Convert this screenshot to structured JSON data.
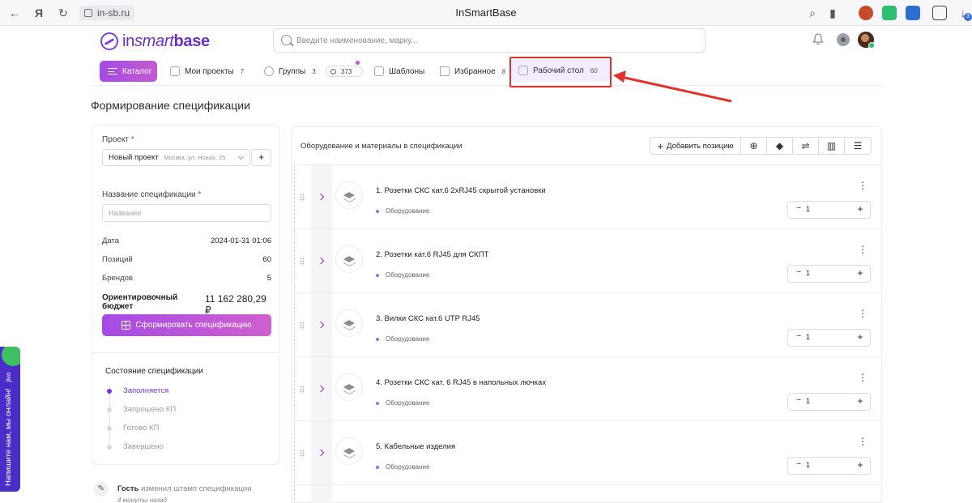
{
  "browser": {
    "url": "in-sb.ru",
    "title": "InSmartBase",
    "download_badge": "3"
  },
  "header": {
    "logo": {
      "part1": "in",
      "part2": "smart",
      "part3": "base"
    },
    "search_placeholder": "Введите наименование, марку..."
  },
  "nav": {
    "catalog": "Каталог",
    "items": [
      {
        "label": "Мои проекты",
        "count": "7"
      },
      {
        "label": "Группы",
        "count": "3"
      },
      {
        "label": "Шаблоны",
        "count": ""
      },
      {
        "label": "Избранное",
        "count": "8"
      },
      {
        "label": "Рабочий стол",
        "count": "60"
      }
    ],
    "badge_count": "373"
  },
  "page": {
    "title": "Формирование спецификации"
  },
  "spec_form": {
    "project_label": "Проект",
    "project_value": "Новый проект",
    "project_address": "Москва, ул. Новая, 25",
    "add_project": "+",
    "name_label": "Название спецификации",
    "name_placeholder": "Название",
    "required_mark": "*",
    "date_label": "Дата",
    "date_value": "2024-01-31 01:06",
    "positions_label": "Позиций",
    "positions_value": "60",
    "brands_label": "Брендов",
    "brands_value": "5",
    "budget_label": "Ориентировочный бюджет",
    "budget_value": "11 162 280,29 ₽",
    "submit_button": "Сформировать спецификацию"
  },
  "spec_status": {
    "title": "Состояние спецификации",
    "steps": [
      {
        "label": "Заполняется",
        "active": true
      },
      {
        "label": "Запрошено КП",
        "active": false
      },
      {
        "label": "Готово КП",
        "active": false
      },
      {
        "label": "Завершено",
        "active": false
      }
    ]
  },
  "activity": {
    "who": "Гость",
    "action": "изменил штамп спецификации",
    "time": "4 минуты назад"
  },
  "equipment": {
    "title": "Оборудование и материалы в спецификации",
    "add_button": "Добавить позицию",
    "items": [
      {
        "name": "1. Розетки СКС кат.6 2хRJ45 скрытой установки",
        "category": "Оборудование",
        "qty": "1"
      },
      {
        "name": "2. Розетки кат.6 RJ45 для СКПТ",
        "category": "Оборудование",
        "qty": "1"
      },
      {
        "name": "3. Вилки СКС кат.6 UTP RJ45",
        "category": "Оборудование",
        "qty": "1"
      },
      {
        "name": "4. Розетки СКС кат. 6 RJ45 в напольных лючках",
        "category": "Оборудование",
        "qty": "1"
      },
      {
        "name": "5. Кабельные изделия",
        "category": "Оборудование",
        "qty": "1"
      }
    ]
  },
  "chat_widget": {
    "text": "Напишите нам, мы онлайн!",
    "brand": "jivo"
  },
  "colors": {
    "accent": "#7a35d8",
    "annotation": "#e2312a"
  }
}
